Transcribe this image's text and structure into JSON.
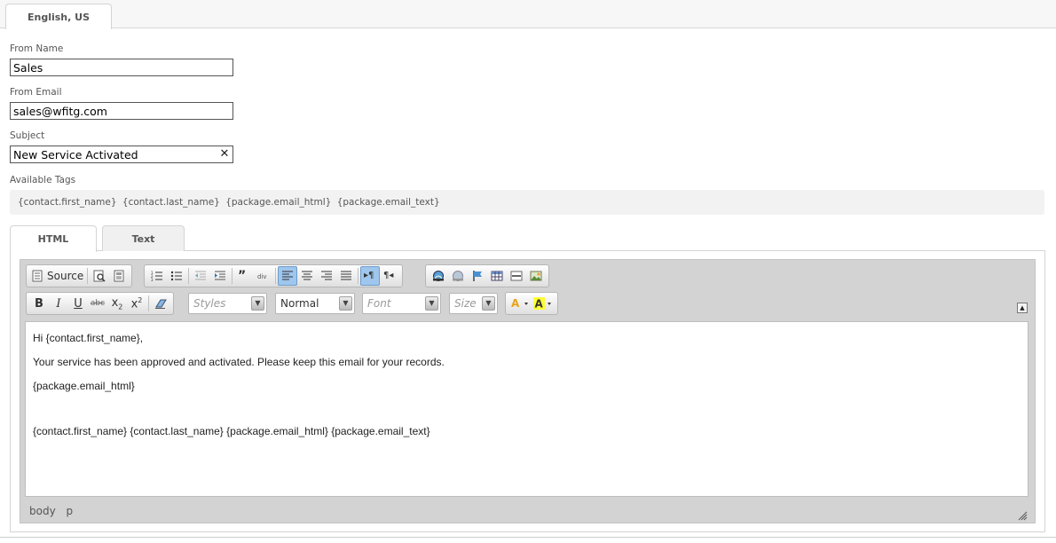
{
  "language_tab": "English, US",
  "form": {
    "from_name_label": "From Name",
    "from_name_value": "Sales",
    "from_email_label": "From Email",
    "from_email_value": "sales@wfitg.com",
    "subject_label": "Subject",
    "subject_value": "New Service Activated"
  },
  "tags": {
    "label": "Available Tags",
    "items": [
      "{contact.first_name}",
      "{contact.last_name}",
      "{package.email_html}",
      "{package.email_text}"
    ]
  },
  "tabs": [
    {
      "label": "HTML",
      "active": true
    },
    {
      "label": "Text",
      "active": false
    }
  ],
  "editor": {
    "toolbar": {
      "source_label": "Source",
      "styles_placeholder": "Styles",
      "format_value": "Normal",
      "font_placeholder": "Font",
      "size_placeholder": "Size"
    },
    "content": {
      "line1": "Hi {contact.first_name},",
      "line2": "Your service has been approved and activated. Please keep this email for your records.",
      "line3": "{package.email_html}",
      "line4": "{contact.first_name} {contact.last_name} {package.email_html} {package.email_text}"
    },
    "status_path": [
      "body",
      "p"
    ]
  },
  "colors": {
    "active_button": "#9fc6ec",
    "editor_frame": "#d3d3d3"
  }
}
